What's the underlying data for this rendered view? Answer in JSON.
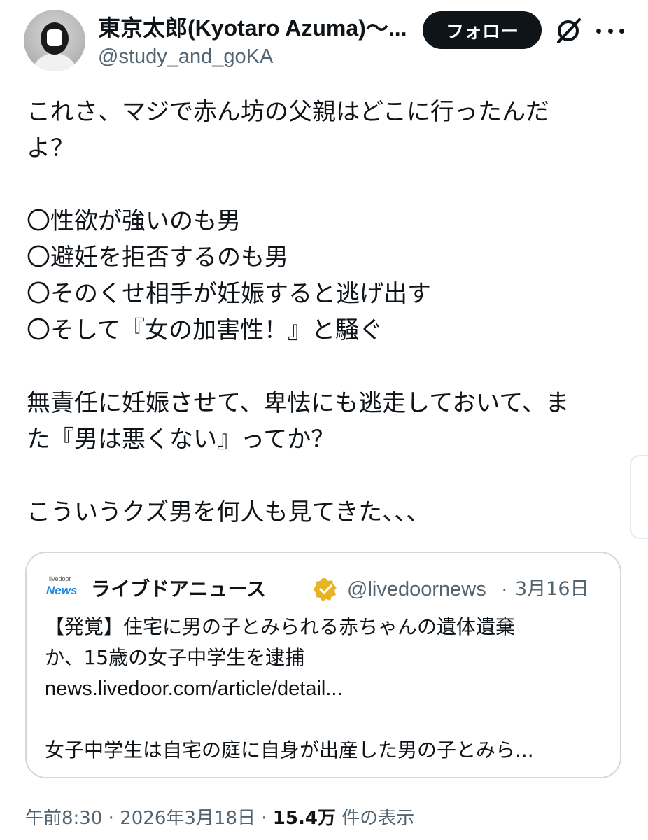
{
  "author": {
    "display_name": "東京太郎(Kyotaro Azuma)〜...",
    "handle": "@study_and_goKA",
    "avatar": "avatar"
  },
  "header": {
    "follow_label": "フォロー",
    "icons": [
      "grok-icon",
      "more-icon"
    ]
  },
  "tweet": {
    "lines": [
      "これさ、マジで赤ん坊の父親はどこに行ったんだ",
      "よ？",
      "",
      "〇性欲が強いのも男",
      "〇避妊を拒否するのも男",
      "〇そのくせ相手が妊娠すると逃げ出す",
      "〇そして『女の加害性！』と騒ぐ",
      "",
      "無責任に妊娠させて、卑怯にも逃走しておいて、ま",
      "た『男は悪くない』ってか？",
      "",
      "こういうクズ男を何人も見てきた、、、"
    ]
  },
  "quote": {
    "logo_small": "livedoor",
    "logo_text": "News",
    "name": "ライブドアニュース",
    "handle": "@livedoornews",
    "separator": "·",
    "date": "3月16日",
    "lines": [
      "【発覚】住宅に男の子とみられる赤ちゃんの遺体遺棄",
      "か、15歳の女子中学生を逮捕",
      "news.livedoor.com/article/detail...",
      "",
      "女子中学生は自宅の庭に自身が出産した男の子とみら..."
    ],
    "verified_color": "#e8b325"
  },
  "footer": {
    "time": "午前8:30",
    "sep1": "·",
    "date": "2026年3月18日",
    "sep2": "·",
    "views_count": "15.4万",
    "views_label": "件の表示"
  }
}
